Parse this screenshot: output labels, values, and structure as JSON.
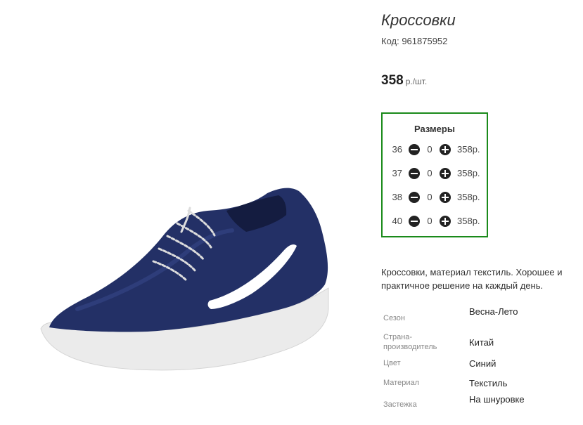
{
  "product": {
    "title": "Кроссовки",
    "code": "Код: 961875952",
    "price": {
      "amount": "358",
      "unit": "р./шт."
    },
    "image_icon": "sneaker-image"
  },
  "sizes": {
    "title": "Размеры",
    "rows": [
      {
        "size": "36",
        "qty": "0",
        "price": "358р."
      },
      {
        "size": "37",
        "qty": "0",
        "price": "358р."
      },
      {
        "size": "38",
        "qty": "0",
        "price": "358р."
      },
      {
        "size": "40",
        "qty": "0",
        "price": "358р."
      }
    ],
    "minus_icon": "minus-circle-icon",
    "plus_icon": "plus-circle-icon",
    "border_color": "#1a8a1a"
  },
  "description": "Кроссовки, материал текстиль. Хорошее и практичное решение на каждый день.",
  "specs": [
    {
      "label": "Сезон",
      "value": "Весна-Лето"
    },
    {
      "label": "Страна-производитель",
      "value": "Китай"
    },
    {
      "label": "Цвет",
      "value": "Синий"
    },
    {
      "label": "Материал",
      "value": "Текстиль"
    },
    {
      "label": "Застежка",
      "value": "На шнуровке"
    }
  ]
}
